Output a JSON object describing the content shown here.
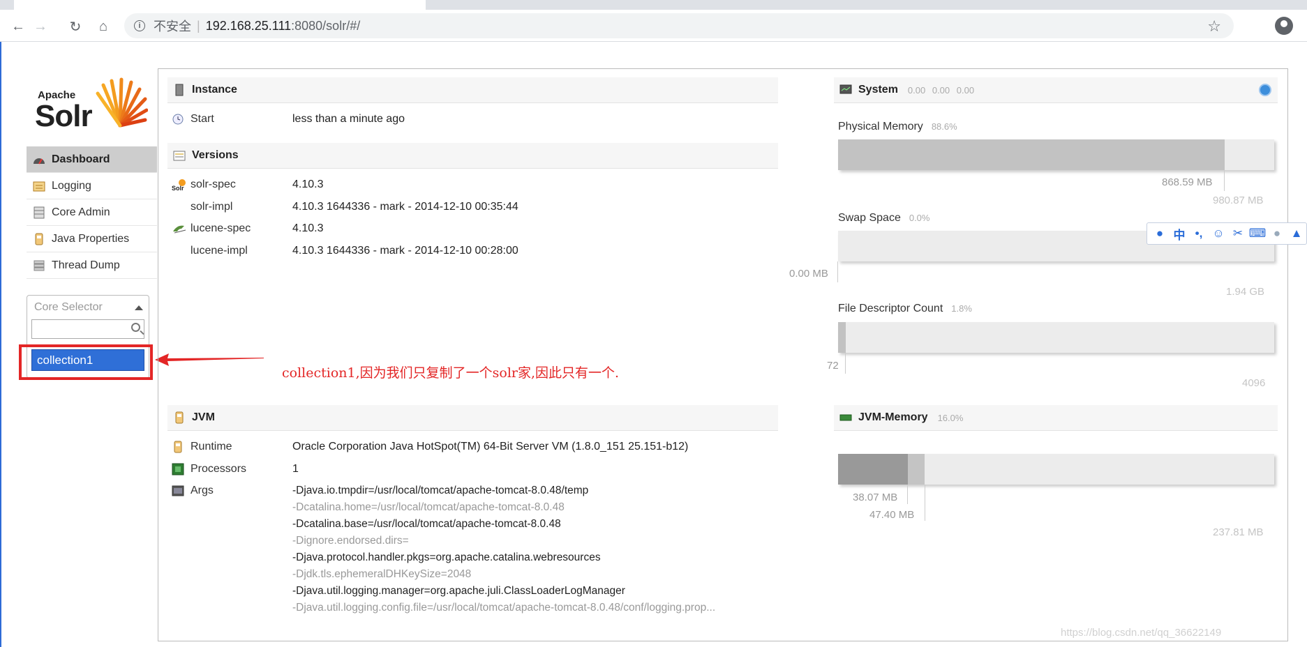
{
  "browser": {
    "insecure_label": "不安全",
    "url_host": "192.168.25.111",
    "url_path": ":8080/solr/#/",
    "separator": "|"
  },
  "logo": {
    "apache": "Apache",
    "solr": "Solr"
  },
  "sidebar": {
    "items": [
      {
        "label": "Dashboard",
        "icon": "dashboard-icon",
        "active": true
      },
      {
        "label": "Logging",
        "icon": "logging-icon"
      },
      {
        "label": "Core Admin",
        "icon": "core-admin-icon"
      },
      {
        "label": "Java Properties",
        "icon": "java-properties-icon"
      },
      {
        "label": "Thread Dump",
        "icon": "thread-dump-icon"
      }
    ],
    "core_selector": {
      "label": "Core Selector",
      "search_value": "",
      "cores": [
        "collection1"
      ]
    }
  },
  "annotation": {
    "text": "collection1,因为我们只复制了一个solr家,因此只有一个.",
    "color": "#e32626"
  },
  "instance": {
    "title": "Instance",
    "start_label": "Start",
    "start_value": "less than a minute ago"
  },
  "versions": {
    "title": "Versions",
    "rows": [
      {
        "label": "solr-spec",
        "value": "4.10.3"
      },
      {
        "label": "solr-impl",
        "value": "4.10.3 1644336 - mark - 2014-12-10 00:35:44"
      },
      {
        "label": "lucene-spec",
        "value": "4.10.3"
      },
      {
        "label": "lucene-impl",
        "value": "4.10.3 1644336 - mark - 2014-12-10 00:28:00"
      }
    ]
  },
  "jvm": {
    "title": "JVM",
    "runtime_label": "Runtime",
    "runtime_value": "Oracle Corporation Java HotSpot(TM) 64-Bit Server VM (1.8.0_151 25.151-b12)",
    "processors_label": "Processors",
    "processors_value": "1",
    "args_label": "Args",
    "args": [
      "-Djava.io.tmpdir=/usr/local/tomcat/apache-tomcat-8.0.48/temp",
      "-Dcatalina.home=/usr/local/tomcat/apache-tomcat-8.0.48",
      "-Dcatalina.base=/usr/local/tomcat/apache-tomcat-8.0.48",
      "-Dignore.endorsed.dirs=",
      "-Djava.protocol.handler.pkgs=org.apache.catalina.webresources",
      "-Djdk.tls.ephemeralDHKeySize=2048",
      "-Djava.util.logging.manager=org.apache.juli.ClassLoaderLogManager",
      "-Djava.util.logging.config.file=/usr/local/tomcat/apache-tomcat-8.0.48/conf/logging.prop..."
    ]
  },
  "system": {
    "title": "System",
    "load_avg": "0.00  0.00  0.00",
    "physical_memory": {
      "label": "Physical Memory",
      "pct": "88.6%",
      "fraction": 0.886,
      "used": "868.59 MB",
      "total": "980.87 MB"
    },
    "swap_space": {
      "label": "Swap Space",
      "pct": "0.0%",
      "fraction": 0.0,
      "used": "0.00 MB",
      "total": "1.94 GB"
    },
    "file_descriptors": {
      "label": "File Descriptor Count",
      "pct": "1.8%",
      "fraction": 0.018,
      "used": "72",
      "total": "4096"
    }
  },
  "jvm_memory": {
    "title": "JVM-Memory",
    "pct": "16.0%",
    "used": "38.07 MB",
    "used_fraction": 0.16,
    "committed": "47.40 MB",
    "committed_fraction": 0.199,
    "max": "237.81 MB"
  },
  "ime_toolbar": {
    "chinese_label": "中"
  },
  "watermark": "https://blog.csdn.net/qq_36622149",
  "colors": {
    "selected_core": "#2f6fd7",
    "annotation_red": "#e32626",
    "gauge_fill": "#c2c2c2",
    "gauge_bg": "#ececec"
  }
}
